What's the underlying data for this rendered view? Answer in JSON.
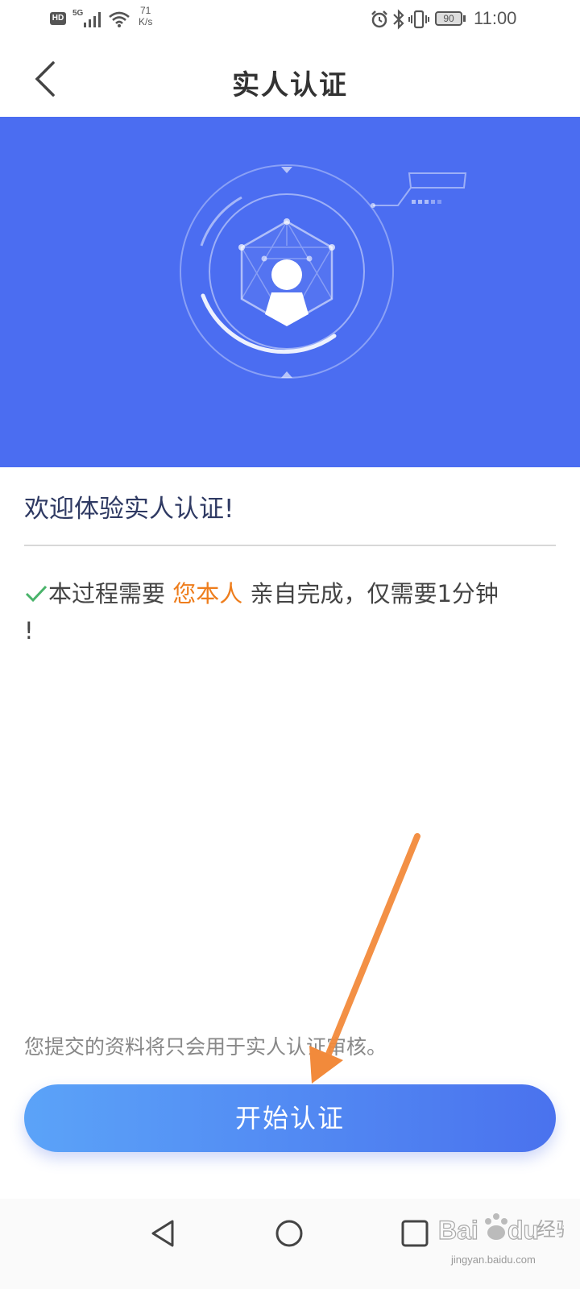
{
  "status_bar": {
    "hd": "HD",
    "network": "5G",
    "speed_value": "71",
    "speed_unit": "K/s",
    "battery": "90",
    "time": "11:00",
    "icons": [
      "signal-icon",
      "wifi-icon",
      "alarm-icon",
      "bluetooth-icon",
      "vibrate-icon",
      "battery-icon"
    ]
  },
  "header": {
    "title": "实人认证",
    "back_icon": "chevron-left-icon"
  },
  "hero": {
    "background_color": "#4b6df1",
    "illustration": "face-recognition-avatar-icon"
  },
  "content": {
    "welcome": "欢迎体验实人认证!",
    "info_prefix": "本过程需要",
    "info_highlight": "您本人",
    "info_suffix": "亲自完成，仅需要1分钟",
    "info_end": "!",
    "check_icon": "check-icon",
    "highlight_color": "#ee7d1c",
    "privacy_note": "您提交的资料将只会用于实人认证审核。"
  },
  "actions": {
    "start_label": "开始认证"
  },
  "nav_bar": {
    "icons": [
      "nav-back-icon",
      "nav-home-icon",
      "nav-recent-icon"
    ]
  },
  "watermark": {
    "logo": "Bai",
    "logo_suffix": "du",
    "label": "经验",
    "url": "jingyan.baidu.com"
  },
  "colors": {
    "accent": "#4b6df1",
    "button_gradient_start": "#5ba3f8",
    "button_gradient_end": "#4a72ee",
    "annotation_arrow": "#f28a3b"
  }
}
